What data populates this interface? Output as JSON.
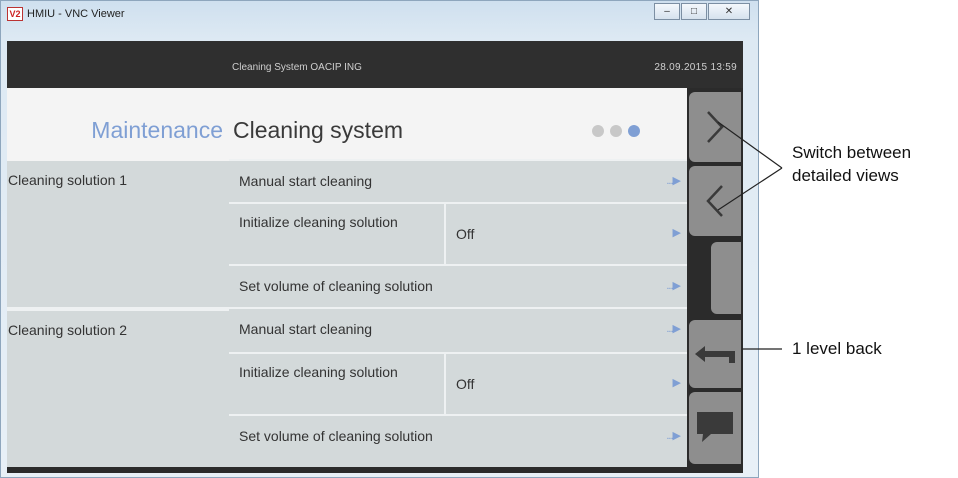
{
  "window": {
    "logo_text": "V2",
    "title": "HMIU - VNC Viewer",
    "controls": [
      "minimize",
      "maximize",
      "close"
    ]
  },
  "hmi": {
    "header": {
      "system_name": "Cleaning System   OACIP ING",
      "datetime": "28.09.2015  13:59"
    },
    "title": {
      "main": "Maintenance",
      "sub": "Cleaning system",
      "page_indicator": {
        "count": 3,
        "active_index": 2
      }
    },
    "groups": [
      {
        "label": "Cleaning solution 1",
        "rows": [
          {
            "label": "Manual start cleaning",
            "value": "",
            "arrow": "...▶"
          },
          {
            "label": "Initialize cleaning solution",
            "value": "Off",
            "arrow": "▶"
          },
          {
            "label": "Set volume of cleaning solution",
            "value": "",
            "arrow": "...▶"
          }
        ]
      },
      {
        "label": "Cleaning solution 2",
        "rows": [
          {
            "label": "Manual start cleaning",
            "value": "",
            "arrow": "...▶"
          },
          {
            "label": "Initialize cleaning solution",
            "value": "Off",
            "arrow": "▶"
          },
          {
            "label": "Set volume of cleaning solution",
            "value": "",
            "arrow": "...▶"
          }
        ]
      }
    ],
    "nav_buttons": [
      {
        "name": "next-view-button",
        "icon": "chevron-right-icon"
      },
      {
        "name": "previous-view-button",
        "icon": "chevron-left-icon"
      },
      {
        "name": "empty-nav-button",
        "icon": ""
      },
      {
        "name": "back-level-button",
        "icon": "back-arrow-icon"
      },
      {
        "name": "messages-button",
        "icon": "speech-bubble-icon"
      }
    ]
  },
  "annotations": {
    "switch_views": "Switch between\ndetailed views",
    "back": "1 level back"
  },
  "colors": {
    "accent_blue": "#7f9fd4",
    "header_dark": "#2f2f2f",
    "row_bg": "#d3d9da",
    "nav_button": "#8e8e8e"
  }
}
